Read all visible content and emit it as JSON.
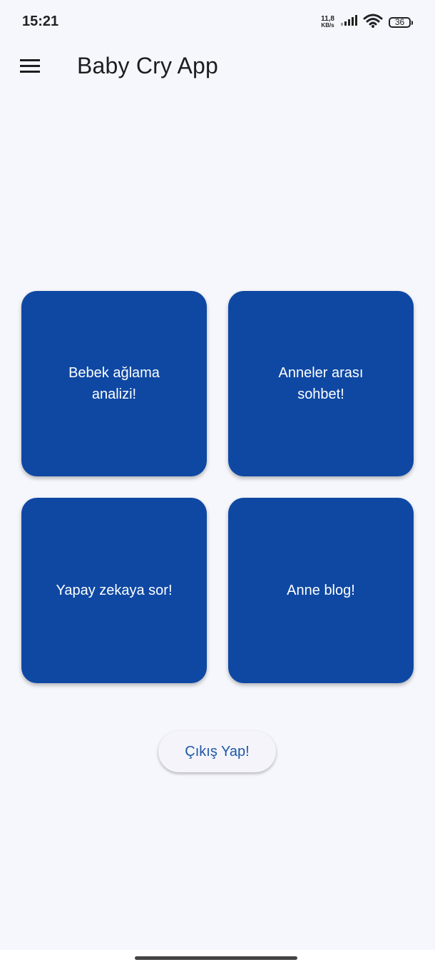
{
  "status_bar": {
    "time": "15:21",
    "net_speed_value": "11,8",
    "net_speed_unit": "KB/s",
    "battery_level": "36"
  },
  "app_bar": {
    "title": "Baby Cry App"
  },
  "tiles": [
    {
      "label": "Bebek ağlama analizi!"
    },
    {
      "label": "Anneler arası sohbet!"
    },
    {
      "label": "Yapay zekaya sor!"
    },
    {
      "label": "Anne blog!"
    }
  ],
  "logout": {
    "label": "Çıkış Yap!"
  },
  "colors": {
    "background": "#f6f7fc",
    "tile": "#0e48a3",
    "tile_text": "#ffffff",
    "logout_text": "#1f57a8"
  }
}
